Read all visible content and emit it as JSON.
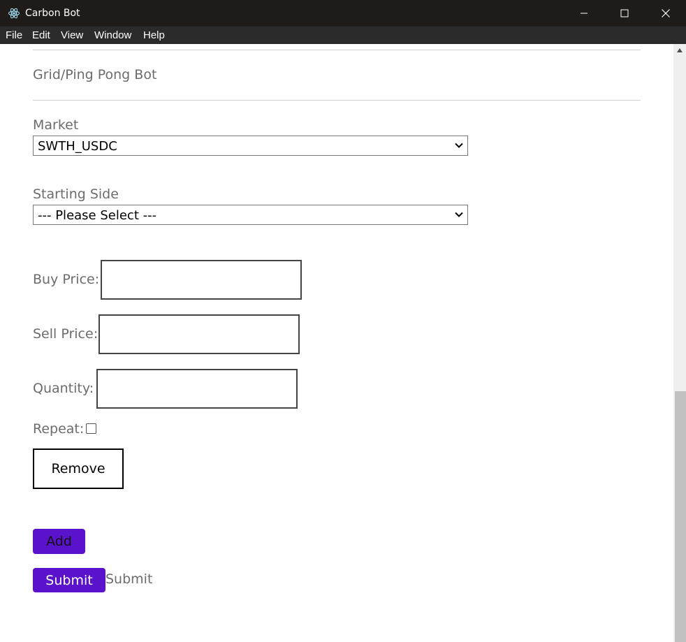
{
  "window": {
    "title": "Carbon Bot"
  },
  "menu": [
    "File",
    "Edit",
    "View",
    "Window",
    "Help"
  ],
  "section": {
    "title": "Grid/Ping Pong Bot"
  },
  "form": {
    "market_label": "Market",
    "market_value": "SWTH_USDC",
    "starting_side_label": "Starting Side",
    "starting_side_value": "--- Please Select ---",
    "buy_price_label": "Buy Price:",
    "sell_price_label": "Sell Price:",
    "quantity_label": "Quantity:",
    "repeat_label": "Repeat:",
    "remove_label": "Remove",
    "add_label": "Add",
    "submit_label": "Submit",
    "submit_text": "Submit"
  },
  "colors": {
    "accent": "#5b12cc",
    "titlebar": "#1f1b18",
    "menubar": "#2b2b2b"
  }
}
